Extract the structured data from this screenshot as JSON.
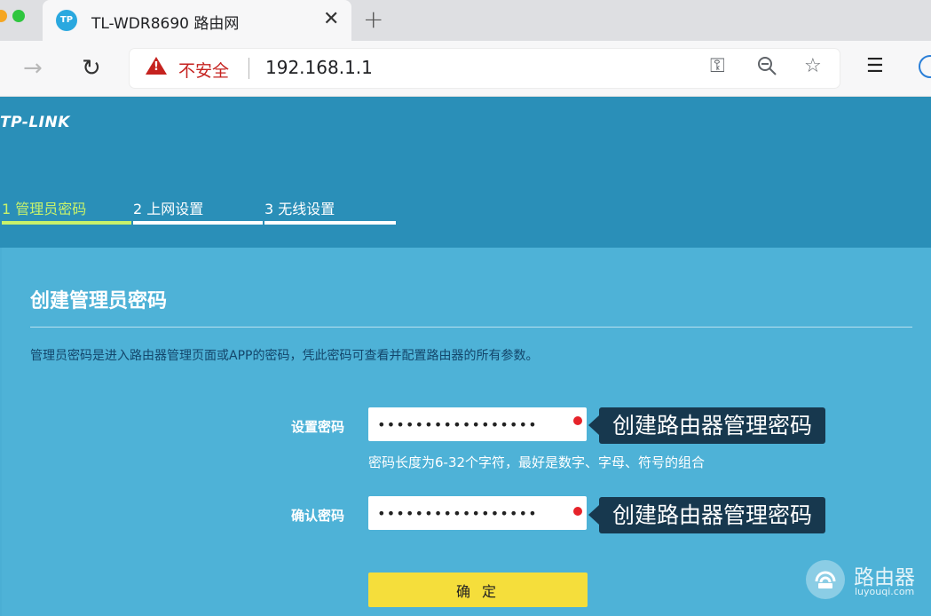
{
  "browser": {
    "tab": {
      "favicon_text": "TP",
      "title": "TL-WDR8690 路由网",
      "close_glyph": "✕"
    },
    "new_tab_glyph": "+",
    "omnibox": {
      "security_label": "不安全",
      "url": "192.168.1.1"
    },
    "icons": [
      "back-arrow-icon",
      "reload-icon",
      "key-icon",
      "zoom-out-icon",
      "star-icon",
      "favorites-icon",
      "profile-icon"
    ]
  },
  "router": {
    "logo": "TP-LINK",
    "steps": [
      {
        "label": "1 管理员密码",
        "active": true,
        "color": "#c8f26b"
      },
      {
        "label": "2 上网设置",
        "active": false,
        "color": "#ffffff"
      },
      {
        "label": "3 无线设置",
        "active": false,
        "color": "#ffffff"
      }
    ],
    "section_title": "创建管理员密码",
    "description": "管理员密码是进入路由器管理页面或APP的密码，凭此密码可查看并配置路由器的所有参数。",
    "fields": [
      {
        "label": "设置密码",
        "value": "•••••••••••••••••",
        "tooltip": "创建路由器管理密码"
      },
      {
        "label": "确认密码",
        "value": "•••••••••••••••••",
        "tooltip": "创建路由器管理密码"
      }
    ],
    "hint": "密码长度为6-32个字符，最好是数字、字母、符号的组合",
    "confirm_label": "确 定"
  },
  "watermark": {
    "text": "路由器",
    "domain": "luyouqi.com"
  },
  "colors": {
    "header": "#2a8fb8",
    "panel": "#4eb2d7",
    "active_step": "#c8f26b",
    "button": "#f5de3b",
    "tooltip": "#17384e",
    "required_dot": "#e6232a"
  }
}
